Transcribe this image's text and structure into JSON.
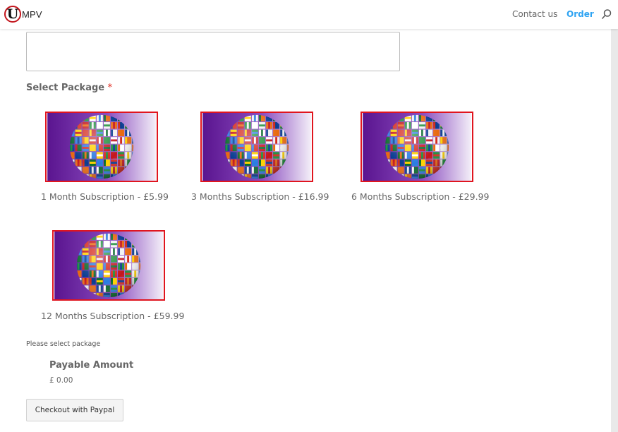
{
  "header": {
    "logo_letter": "U",
    "logo_text": "MPV",
    "nav": {
      "contact": "Contact us",
      "order": "Order"
    },
    "search_icon": "search-icon"
  },
  "form": {
    "message_value": "",
    "package_label": "Select Package",
    "required_mark": "*",
    "packages": [
      {
        "label": "1 Month Subscription - £5.99"
      },
      {
        "label": "3 Months Subscription - £16.99"
      },
      {
        "label": "6 Months Subscription - £29.99"
      },
      {
        "label": "12 Months Subscription - £59.99"
      }
    ],
    "select_message": "Please select package",
    "payable_title": "Payable Amount",
    "payable_amount": "£ 0.00",
    "checkout_label": "Checkout with Paypal"
  },
  "colors": {
    "accent": "#2ea3f2",
    "required": "#e02b20",
    "package_border": "#e0151f",
    "package_bg": "#6a1fa0"
  }
}
